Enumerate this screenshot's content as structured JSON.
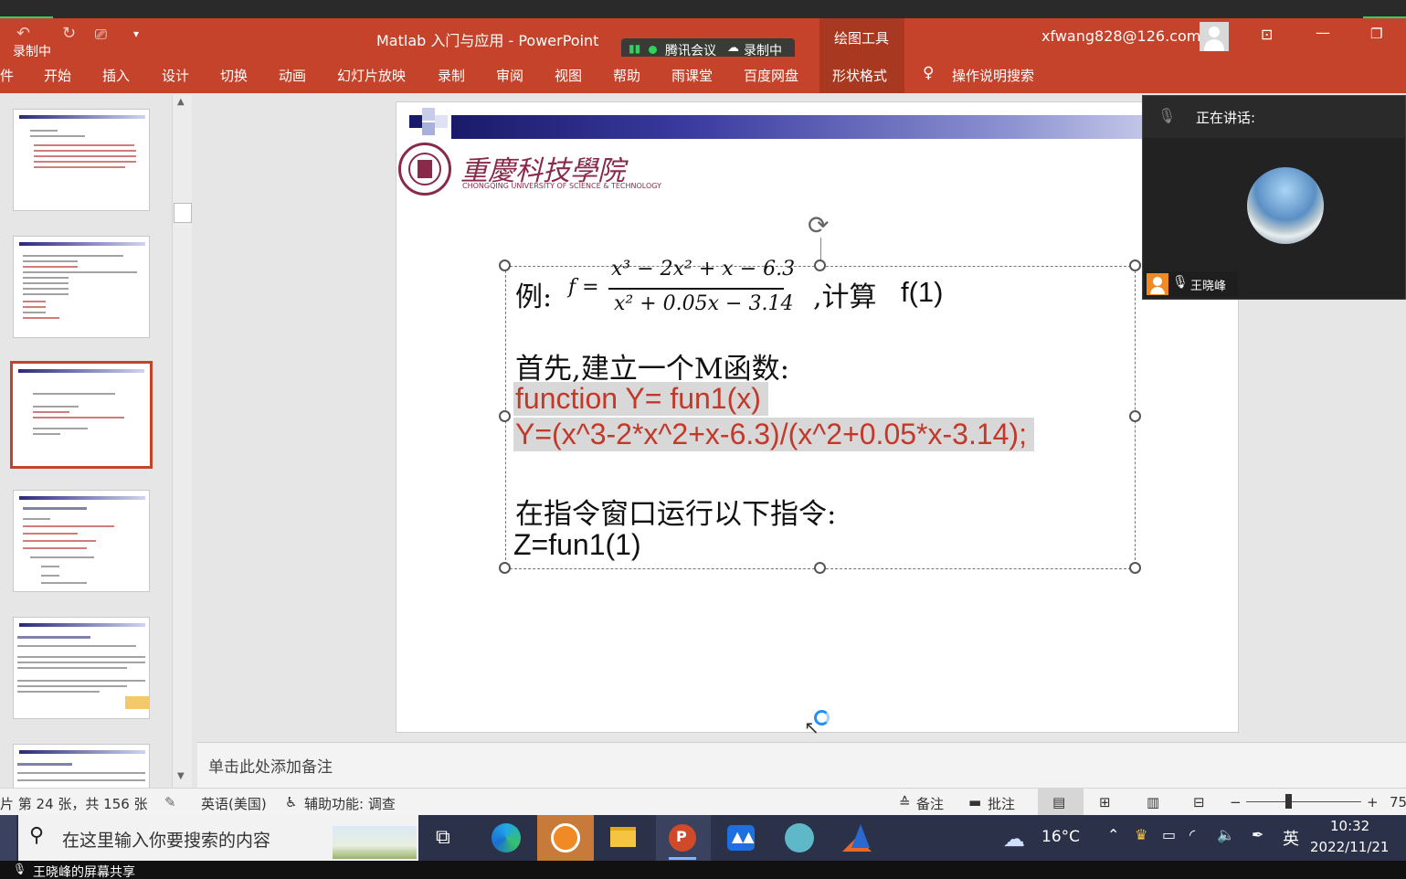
{
  "window": {
    "recording_label": "录制中",
    "title": "Matlab 入门与应用  -  PowerPoint",
    "meeting_app": "腾讯会议",
    "meeting_recording": "录制中",
    "context_tab": "绘图工具",
    "account": "xfwang828@126.com"
  },
  "ribbon": {
    "tabs": [
      "件",
      "开始",
      "插入",
      "设计",
      "切换",
      "动画",
      "幻灯片放映",
      "录制",
      "审阅",
      "视图",
      "帮助",
      "雨课堂",
      "百度网盘",
      "形状格式"
    ],
    "search": "操作说明搜索"
  },
  "slide": {
    "example_prefix": "例:",
    "formula_lhs": "f =",
    "numerator": "x³ − 2x² + x − 6.3",
    "denominator": "x² + 0.05x − 3.14",
    "compute": ",计算",
    "f1": "f(1)",
    "step1": "首先,建立一个M函数:",
    "code1": "function Y= fun1(x)",
    "code2": "Y=(x^3-2*x^2+x-6.3)/(x^2+0.05*x-3.14);",
    "step2": "在指令窗口运行以下指令:",
    "cmd": "Z=fun1(1)",
    "logo_cn": "重慶科技學院",
    "logo_en": "CHONGQING UNIVERSITY OF SCIENCE & TECHNOLOGY"
  },
  "notes": {
    "placeholder": "单击此处添加备注"
  },
  "status": {
    "slide_count": "片 第 24 张，共 156 张",
    "language": "英语(美国)",
    "accessibility": "辅助功能: 调查",
    "notes_btn": "备注",
    "comments_btn": "批注",
    "zoom": "75"
  },
  "meeting_panel": {
    "speaking": "正在讲话:",
    "participant": "王晓峰"
  },
  "taskbar": {
    "search_placeholder": "在这里输入你要搜索的内容",
    "weather": "16°C",
    "ime": "英",
    "time": "10:32",
    "date": "2022/11/21"
  },
  "share_label": "王晓峰的屏幕共享",
  "colors": {
    "ribbon": "#c4432a",
    "code_red": "#c0392b",
    "taskbar": "#2b3148"
  }
}
